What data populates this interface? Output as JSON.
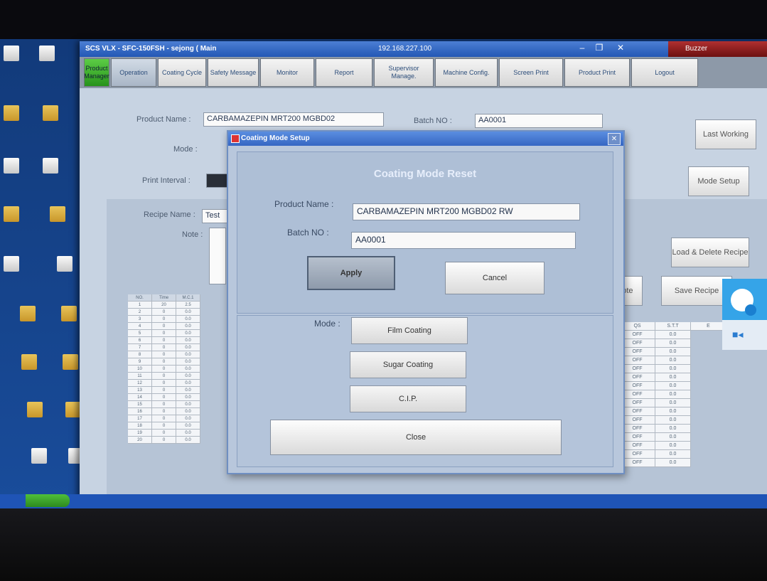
{
  "window": {
    "title": "SCS VLX - SFC-150FSH - sejong ( Main",
    "ip": "192.168.227.100",
    "buzzer": "Buzzer",
    "minimize": "–",
    "restore": "❐",
    "close": "✕"
  },
  "menu": [
    {
      "label": "Product Manager"
    },
    {
      "label": "Operation"
    },
    {
      "label": "Coating Cycle"
    },
    {
      "label": "Safety Message"
    },
    {
      "label": "Monitor"
    },
    {
      "label": "Report"
    },
    {
      "label": "Supervisor Manage."
    },
    {
      "label": "Machine Config."
    },
    {
      "label": "Screen Print"
    },
    {
      "label": "Product Print"
    },
    {
      "label": "Logout"
    }
  ],
  "form": {
    "product_name_label": "Product Name :",
    "product_name_value": "CARBAMAZEPIN MRT200 MGBD02",
    "batch_label": "Batch NO :",
    "batch_value": "AA0001",
    "mode_label": "Mode :",
    "print_interval_label": "Print Interval :",
    "recipe_name_label": "Recipe Name :",
    "recipe_name_value": "Test",
    "note_label": "Note :"
  },
  "side_buttons": {
    "last_working": "Last Working",
    "mode_setup": "Mode Setup",
    "load_delete_recipe": "Load & Delete Recipe",
    "save_recipe": "Save Recipe",
    "recipe_note": "ipe ote"
  },
  "grid": {
    "headers": [
      "NO.",
      "Time",
      "M.C.1"
    ],
    "rows": [
      [
        "1",
        "20",
        "2.5"
      ],
      [
        "2",
        "0",
        "0.0"
      ],
      [
        "3",
        "0",
        "0.0"
      ],
      [
        "4",
        "0",
        "0.0"
      ],
      [
        "5",
        "0",
        "0.0"
      ],
      [
        "6",
        "0",
        "0.0"
      ],
      [
        "7",
        "0",
        "0.0"
      ],
      [
        "8",
        "0",
        "0.0"
      ],
      [
        "9",
        "0",
        "0.0"
      ],
      [
        "10",
        "0",
        "0.0"
      ],
      [
        "11",
        "0",
        "0.0"
      ],
      [
        "12",
        "0",
        "0.0"
      ],
      [
        "13",
        "0",
        "0.0"
      ],
      [
        "14",
        "0",
        "0.0"
      ],
      [
        "15",
        "0",
        "0.0"
      ],
      [
        "16",
        "0",
        "0.0"
      ],
      [
        "17",
        "0",
        "0.0"
      ],
      [
        "18",
        "0",
        "0.0"
      ],
      [
        "19",
        "0",
        "0.0"
      ],
      [
        "20",
        "0",
        "0.0"
      ]
    ],
    "right_headers": [
      "QS",
      "S.T.T",
      "E"
    ],
    "right_rows": [
      [
        "OFF",
        "0.0"
      ],
      [
        "OFF",
        "0.0"
      ],
      [
        "OFF",
        "0.0"
      ],
      [
        "OFF",
        "0.0"
      ],
      [
        "OFF",
        "0.0"
      ],
      [
        "OFF",
        "0.0"
      ],
      [
        "OFF",
        "0.0"
      ],
      [
        "OFF",
        "0.0"
      ],
      [
        "OFF",
        "0.0"
      ],
      [
        "OFF",
        "0.0"
      ],
      [
        "OFF",
        "0.0"
      ],
      [
        "OFF",
        "0.0"
      ],
      [
        "OFF",
        "0.0"
      ],
      [
        "OFF",
        "0.0"
      ],
      [
        "OFF",
        "0.0"
      ],
      [
        "OFF",
        "0.0"
      ]
    ]
  },
  "modal": {
    "title": "Coating Mode Setup",
    "heading": "Coating Mode Reset",
    "product_name_label": "Product Name :",
    "product_name_value": "CARBAMAZEPIN MRT200 MGBD02 RW",
    "batch_label": "Batch NO :",
    "batch_value": "AA0001",
    "apply": "Apply",
    "cancel": "Cancel",
    "mode_label": "Mode :",
    "film_coating": "Film Coating",
    "sugar_coating": "Sugar Coating",
    "cip": "C.I.P.",
    "close": "Close"
  },
  "colors": {
    "active_menu": "#3fb02f",
    "title_bar": "#2f64c0",
    "modal_bg": "#b8c7dc"
  }
}
